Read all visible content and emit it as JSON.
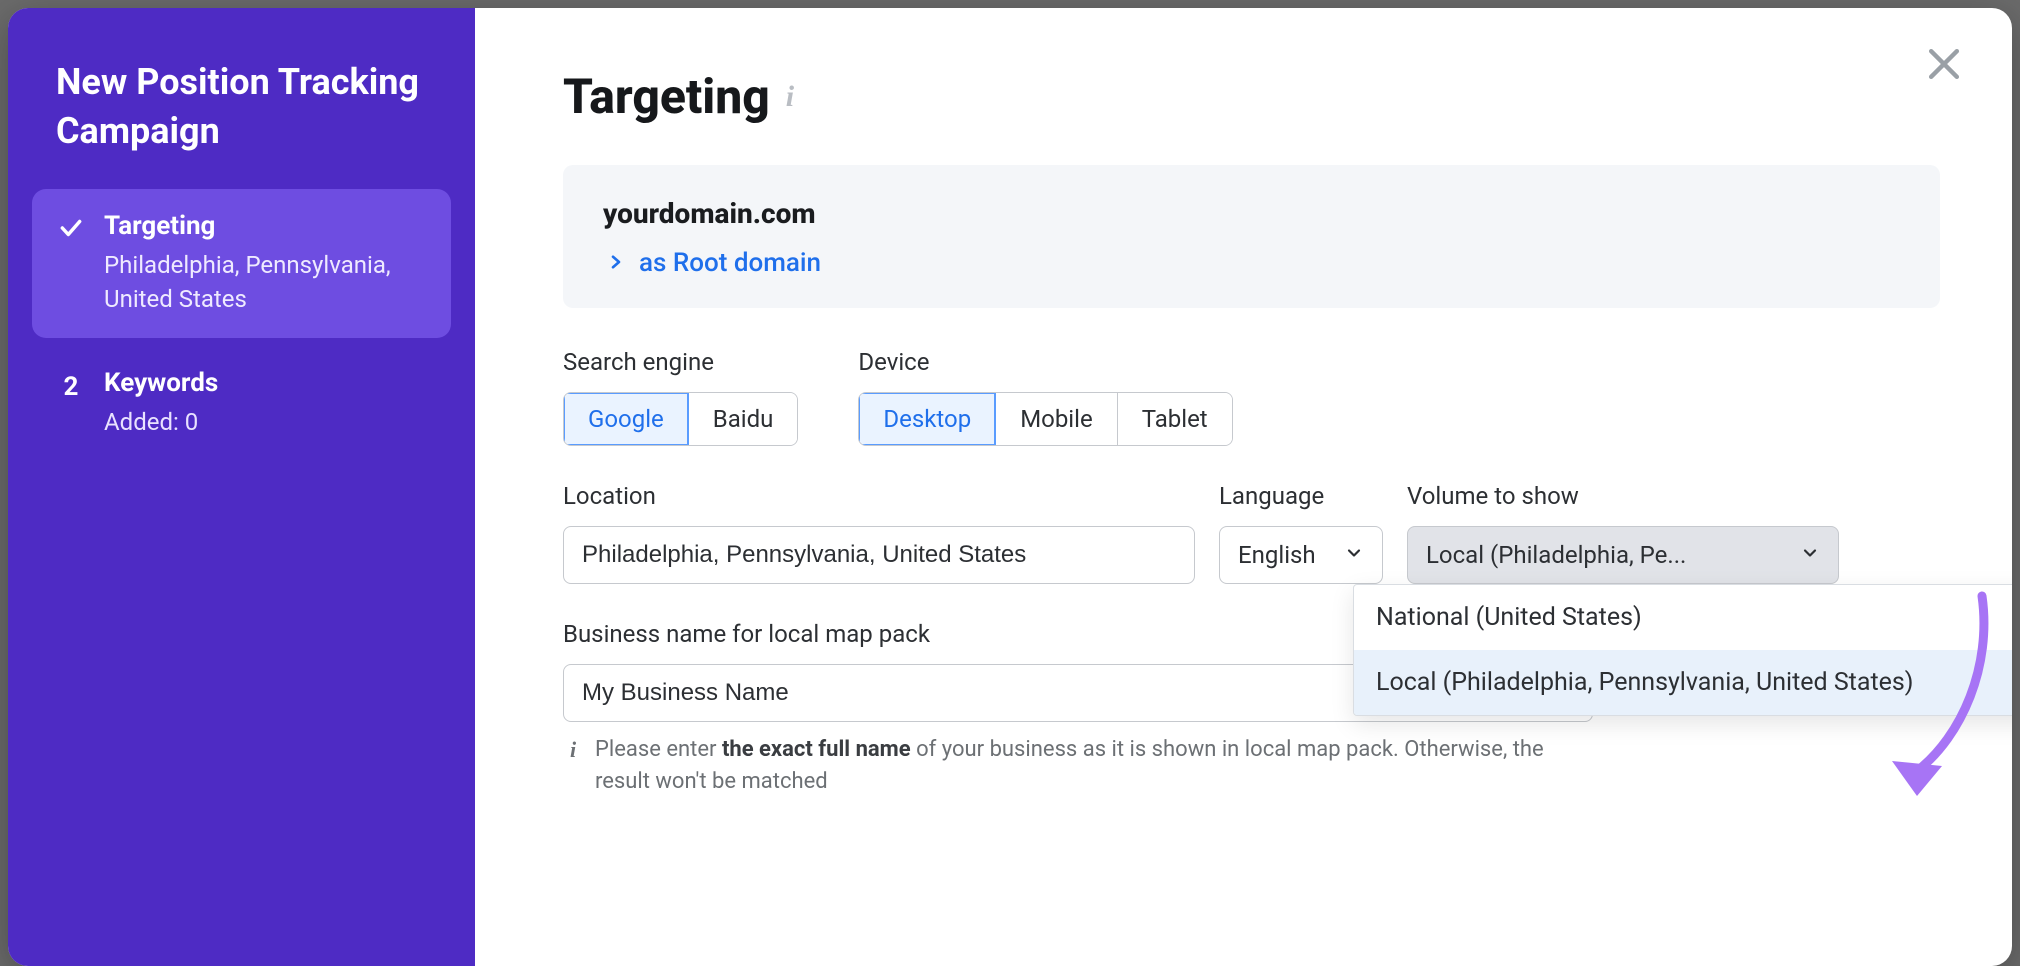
{
  "sidebar": {
    "title": "New Position Tracking Campaign",
    "steps": [
      {
        "label": "Targeting",
        "sub": "Philadelphia, Pennsylvania, United States",
        "active": true,
        "completed": true
      },
      {
        "label": "Keywords",
        "sub": "Added: 0",
        "active": false,
        "num": "2"
      }
    ]
  },
  "header": {
    "title": "Targeting"
  },
  "domain": {
    "name": "yourdomain.com",
    "mode": "as Root domain"
  },
  "search_engine": {
    "label": "Search engine",
    "options": [
      "Google",
      "Baidu"
    ],
    "selected": "Google"
  },
  "device": {
    "label": "Device",
    "options": [
      "Desktop",
      "Mobile",
      "Tablet"
    ],
    "selected": "Desktop"
  },
  "location": {
    "label": "Location",
    "value": "Philadelphia, Pennsylvania, United States"
  },
  "language": {
    "label": "Language",
    "value": "English"
  },
  "volume": {
    "label": "Volume to show",
    "value_short": "Local (Philadelphia, Pe...",
    "options": [
      "National (United States)",
      "Local (Philadelphia, Pennsylvania, United States)"
    ],
    "highlighted": "Local (Philadelphia, Pennsylvania, United States)"
  },
  "business": {
    "label": "Business name for local map pack",
    "value": "My Business Name",
    "hint_before": "Please enter ",
    "hint_bold": "the exact full name",
    "hint_after": " of your business as it is shown in local map pack. Otherwise, the result won't be matched"
  },
  "colors": {
    "brand_purple": "#4e2bc4",
    "accent_blue": "#1f6feb",
    "annotation_purple": "#a774f5"
  }
}
